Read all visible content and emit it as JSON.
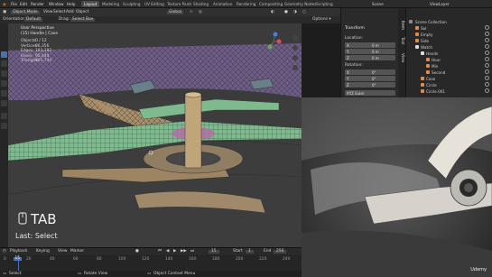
{
  "menu": {
    "items": [
      "File",
      "Edit",
      "Render",
      "Window",
      "Help"
    ],
    "workspaces": [
      "Layout",
      "Modeling",
      "Sculpting",
      "UV Editing",
      "Texture Paint",
      "Shading",
      "Animation",
      "Rendering",
      "Compositing",
      "Geometry Nodes",
      "Scripting"
    ],
    "active_workspace": "Layout",
    "scene": "Scene",
    "view_layer": "ViewLayer"
  },
  "header": {
    "mode": "Object Mode",
    "menus": [
      "View",
      "Select",
      "Add",
      "Object"
    ],
    "transform_orientation": "Global",
    "orientation_label": "Orientation:",
    "orientation_value": "Default",
    "drag_label": "Drag:",
    "drag_value": "Select Box"
  },
  "viewport": {
    "view_name": "User Perspective",
    "object_name": "(15) Handle | Case",
    "stats": [
      {
        "label": "Objects",
        "value": "0 / 12"
      },
      {
        "label": "Vertices",
        "value": "96,356"
      },
      {
        "label": "Edges",
        "value": "193,192"
      },
      {
        "label": "Faces",
        "value": "95,444"
      },
      {
        "label": "Triangles",
        "value": "191,744"
      }
    ],
    "key_overlay": "TAB",
    "last_op": "Last: Select"
  },
  "npanel": {
    "title": "Transform",
    "location_label": "Location:",
    "rotation_label": "Rotation:",
    "axes": [
      "X",
      "Y",
      "Z"
    ],
    "location_values": [
      "0 m",
      "0 m",
      "0 m"
    ],
    "rotation_values": [
      "0°",
      "0°",
      "0°"
    ],
    "rotation_mode": "XYZ Euler",
    "tabs": [
      "Item",
      "Tool",
      "View"
    ]
  },
  "outliner": {
    "title": "Scene Collection",
    "rows": [
      {
        "label": "Scene Collection",
        "indent": 0
      },
      {
        "label": "Sol",
        "indent": 1
      },
      {
        "label": "Empty",
        "indent": 1
      },
      {
        "label": "Side",
        "indent": 1
      },
      {
        "label": "Watch",
        "indent": 1
      },
      {
        "label": "Hands",
        "indent": 2
      },
      {
        "label": "Hour",
        "indent": 3
      },
      {
        "label": "Min",
        "indent": 3
      },
      {
        "label": "Second",
        "indent": 3
      },
      {
        "label": "Case",
        "indent": 2
      },
      {
        "label": "Circle",
        "indent": 2
      },
      {
        "label": "Circle.001",
        "indent": 2
      }
    ]
  },
  "timeline": {
    "menus": [
      "Playback",
      "Keying",
      "View",
      "Marker"
    ],
    "current_frame": "15",
    "start_label": "Start",
    "start": "1",
    "end_label": "End",
    "end": "250",
    "ticks": [
      "0",
      "20",
      "40",
      "60",
      "80",
      "100",
      "120",
      "140",
      "160",
      "180",
      "200",
      "220",
      "240"
    ],
    "status_items": [
      "Select",
      "Rotate View",
      "Object Context Menu"
    ]
  },
  "watermark": "Udemy",
  "colors": {
    "accent": "#4772b3",
    "selected_mesh": "#7fb98e",
    "viewport_bg": "#3b3b3b",
    "purple_bg": "#6a5a82"
  }
}
